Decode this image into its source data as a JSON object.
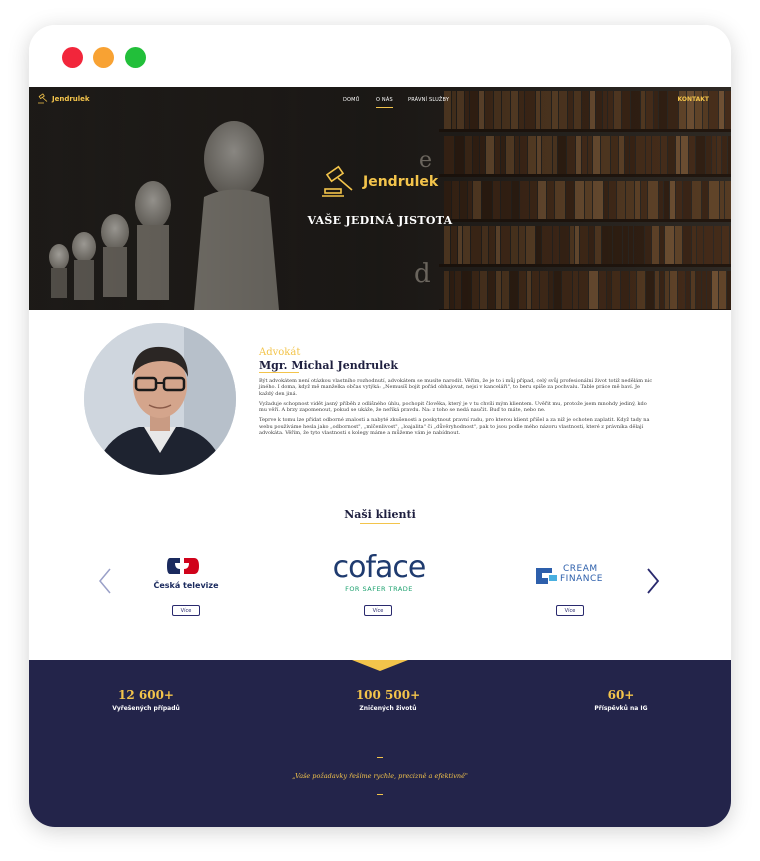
{
  "window": {
    "buttons": [
      "close",
      "minimize",
      "maximize"
    ]
  },
  "nav": {
    "brand": "Jendrulek",
    "items": [
      {
        "label": "DOMŮ"
      },
      {
        "label": "O NÁS"
      },
      {
        "label": "PRÁVNÍ SLUŽBY"
      }
    ],
    "active_item": "O NÁS",
    "cta": "KONTAKT"
  },
  "hero": {
    "brand": "Jendrulek",
    "tagline": "VAŠE JEDINÁ JISTOTA"
  },
  "about": {
    "role": "Advokát",
    "name": "Mgr. Michal Jendrulek",
    "paragraphs": [
      "Být advokátem není otázkou vlastního rozhodnutí, advokátem se musíte narodit. Věřím, že je to i můj případ, celý svůj profesionální život totiž nedělám nic jiného. I doma, když mě manželka občas vytýká: „Nemusíš bojit pořád obhajovat, nejsi v kanceláři\", to beru spíše za pochvalu. Table práce mě baví. Je každý den jiná.",
      "Vyžaduje schopnost vidět jasný příběh z odlišného úhlu, pochopit člověka, který je v tu chvíli mým klientem. Uvěřit mu, protože jsem mnohdy jediný, kdo mu věří. A brzy zapomenout, pokud se ukáže, že neříká pravdu. Na: z toho se nedá naučit. Buď to máte, nebo ne.",
      "Teprve k tomu lze přidat odborné znalosti a nabyté zkušenosti a poskytnout pravní radu, pro kterou klient přišel a za níž je ochoten zaplatit. Když tady na webu používáme hesla jako „odbornost\", „mlčenlivost\", „loajalita\" či „důvěryhodnost\", pak to jsou podle mého názoru vlastnosti, které z právníka dělají advokáta. Věřím, že tyto vlastnosti s kolegy máme a můžeme vám je nabídnout."
    ]
  },
  "clients": {
    "title": "Naši klienti",
    "items": [
      {
        "name": "Česká televize",
        "button": "Více"
      },
      {
        "name": "coface",
        "subtitle": "FOR SAFER TRADE",
        "button": "Více"
      },
      {
        "name": "CREAM",
        "name2": "FINANCE",
        "button": "Více"
      }
    ]
  },
  "stats": {
    "items": [
      {
        "value": "12 600+",
        "label": "Vyřešených případů"
      },
      {
        "value": "100 500+",
        "label": "Zničených životů"
      },
      {
        "value": "60+",
        "label": "Příspěvků na IG"
      }
    ],
    "quote": "„Vaše požadavky řešíme rychle, precizně a efektivně\""
  },
  "colors": {
    "accent": "#f3c44b",
    "navy": "#23244a",
    "text_dark": "#1e1f3f",
    "ct_red": "#d0021b",
    "ct_navy": "#1a2a5e",
    "coface_blue": "#1f3b6f",
    "coface_green": "#1aa06d",
    "cream_blue": "#2d5fab"
  },
  "icons": [
    "gavel-icon",
    "chevron-left-icon",
    "chevron-right-icon"
  ]
}
